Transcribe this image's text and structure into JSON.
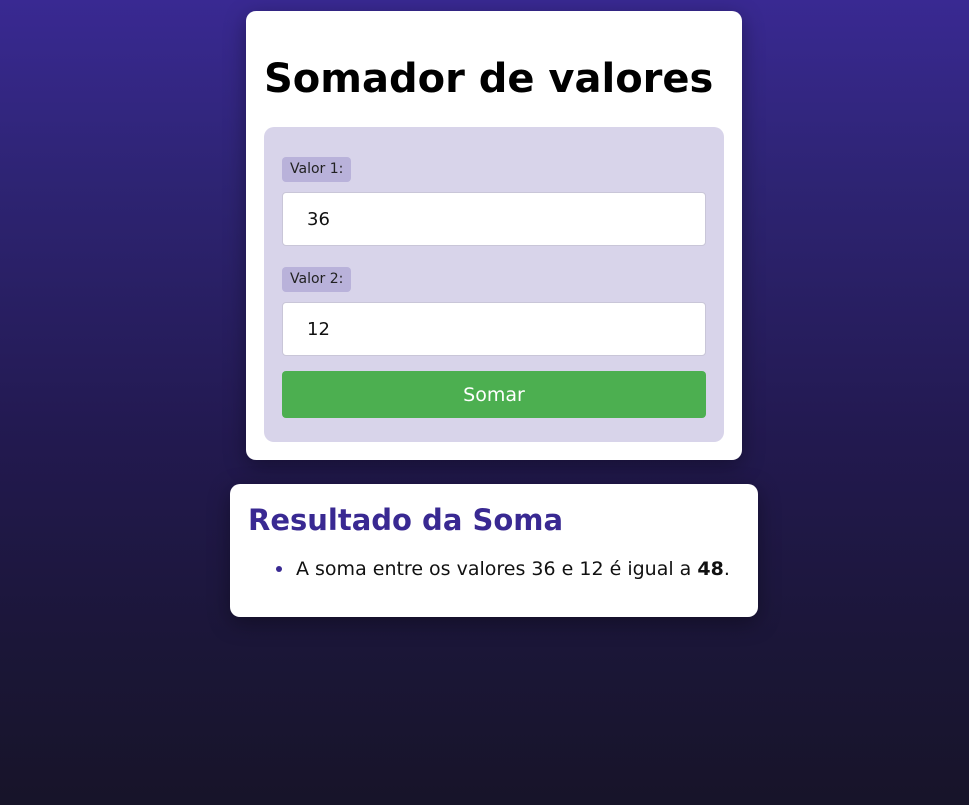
{
  "page": {
    "title": "Somador de valores"
  },
  "form": {
    "label1": "Valor 1:",
    "value1": "36",
    "label2": "Valor 2:",
    "value2": "12",
    "button_label": "Somar"
  },
  "result": {
    "title": "Resultado da Soma",
    "text_before": "A soma entre os valores 36 e 12 é igual a ",
    "sum": "48",
    "text_after": "."
  },
  "colors": {
    "accent": "#392992",
    "button": "#4caf50",
    "panel": "#d8d4ea",
    "label_bg": "#b9b2da"
  }
}
